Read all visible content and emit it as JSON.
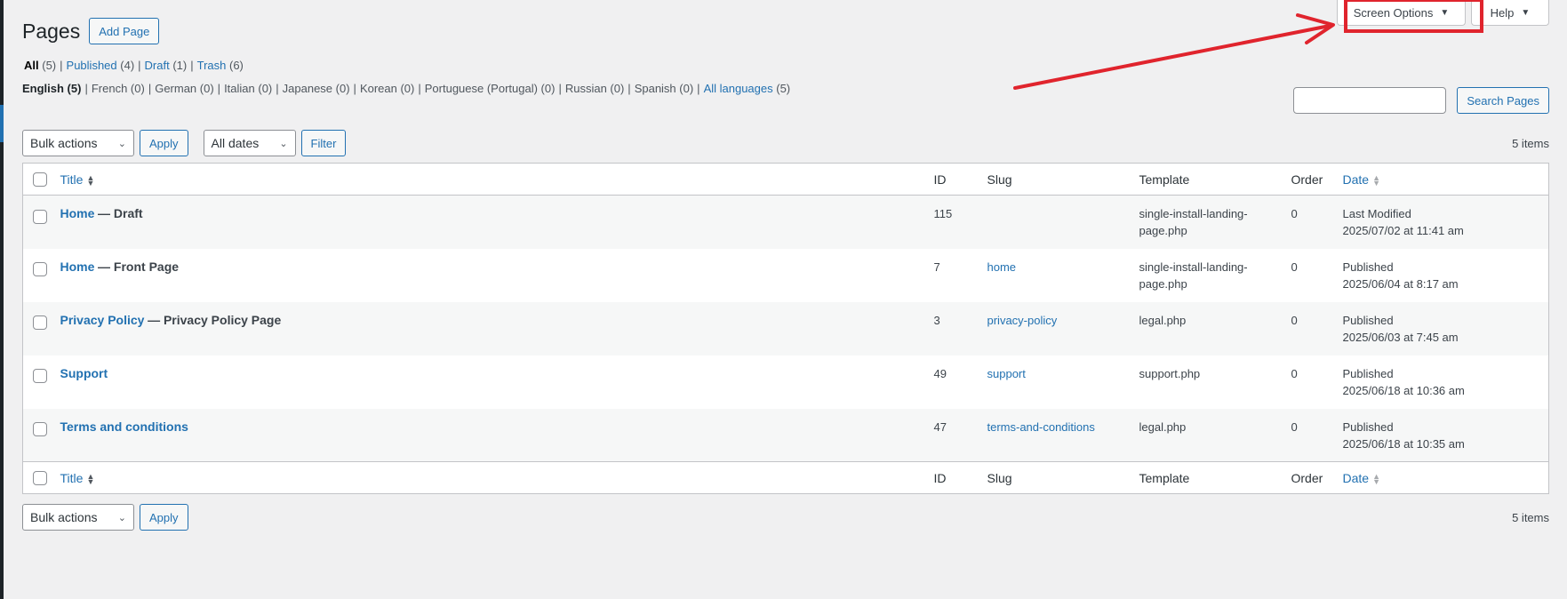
{
  "screen_meta": {
    "screen_options_label": "Screen Options",
    "help_label": "Help"
  },
  "header": {
    "title": "Pages",
    "add_new_label": "Add Page"
  },
  "status_filters": [
    {
      "label": "All",
      "count": "(5)",
      "current": true
    },
    {
      "label": "Published",
      "count": "(4)",
      "current": false
    },
    {
      "label": "Draft",
      "count": "(1)",
      "current": false
    },
    {
      "label": "Trash",
      "count": "(6)",
      "current": false
    }
  ],
  "language_filters": [
    {
      "label": "English (5)",
      "current": true
    },
    {
      "label": "French (0)"
    },
    {
      "label": "German (0)"
    },
    {
      "label": "Italian (0)"
    },
    {
      "label": "Japanese (0)"
    },
    {
      "label": "Korean (0)"
    },
    {
      "label": "Portuguese (Portugal) (0)"
    },
    {
      "label": "Russian (0)"
    },
    {
      "label": "Spanish (0)"
    }
  ],
  "all_languages": {
    "label": "All languages",
    "count": "(5)"
  },
  "search": {
    "placeholder": "",
    "button_label": "Search Pages"
  },
  "tablenav_top": {
    "bulk_actions": "Bulk actions",
    "apply_label": "Apply",
    "dates": "All dates",
    "filter_label": "Filter",
    "items_count": "5 items"
  },
  "tablenav_bottom": {
    "bulk_actions": "Bulk actions",
    "apply_label": "Apply",
    "items_count": "5 items"
  },
  "columns": {
    "title": "Title",
    "id": "ID",
    "slug": "Slug",
    "template": "Template",
    "order": "Order",
    "date": "Date"
  },
  "rows": [
    {
      "title": "Home",
      "state": "— Draft",
      "id": "115",
      "slug": "",
      "template": "single-install-landing-page.php",
      "order": "0",
      "date_status": "Last Modified",
      "date": "2025/07/02 at 11:41 am"
    },
    {
      "title": "Home",
      "state": "— Front Page",
      "id": "7",
      "slug": "home",
      "template": "single-install-landing-page.php",
      "order": "0",
      "date_status": "Published",
      "date": "2025/06/04 at 8:17 am"
    },
    {
      "title": "Privacy Policy",
      "state": "— Privacy Policy Page",
      "id": "3",
      "slug": "privacy-policy",
      "template": "legal.php",
      "order": "0",
      "date_status": "Published",
      "date": "2025/06/03 at 7:45 am"
    },
    {
      "title": "Support",
      "state": "",
      "id": "49",
      "slug": "support",
      "template": "support.php",
      "order": "0",
      "date_status": "Published",
      "date": "2025/06/18 at 10:36 am"
    },
    {
      "title": "Terms and conditions",
      "state": "",
      "id": "47",
      "slug": "terms-and-conditions",
      "template": "legal.php",
      "order": "0",
      "date_status": "Published",
      "date": "2025/06/18 at 10:35 am"
    }
  ],
  "colors": {
    "link": "#2271b1",
    "annotation": "#e0242d",
    "background": "#f0f0f1"
  }
}
